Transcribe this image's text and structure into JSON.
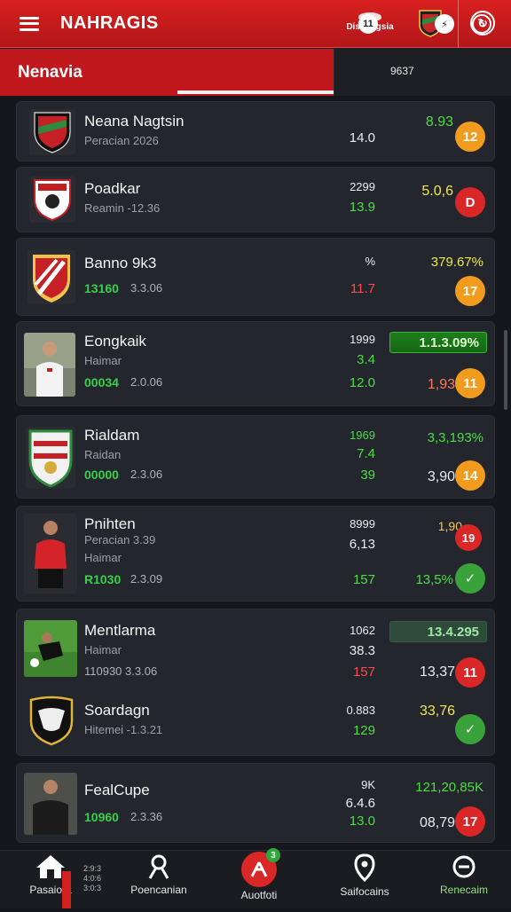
{
  "app": {
    "title": "NAHRAGIS",
    "brand": "Disbangsia"
  },
  "tab": {
    "title": "Nenavia",
    "notification_count": "11",
    "count_label": "9637",
    "right_pill": "6"
  },
  "cards": [
    {
      "name": "Neana Nagtsin",
      "sub": "Peracian 2026",
      "mid1": "14.0",
      "right1": "8.93",
      "badge": "12",
      "badge_color": "#f29c1f"
    },
    {
      "name": "Poadkar",
      "sub": "Reamin -12.36",
      "mid1": "2299",
      "mid2": "13.9",
      "right1": "5.0,6",
      "badge": "D",
      "badge_color": "#d92626"
    },
    {
      "name": "Banno 9k3",
      "sub_green": "13160",
      "sub_grey": "3.3.06",
      "mid1": "%",
      "mid2": "11.7",
      "right1": "379.67%",
      "badge": "17",
      "badge_color": "#f29c1f"
    },
    {
      "name": "Eongkaik",
      "sub": "Haimar",
      "sub_green": "00034",
      "sub_grey": "2.0.06",
      "mid1": "1999",
      "mid2": "3.4",
      "mid3": "12.0",
      "bar": "1.1.3.09%",
      "right2": "1,93",
      "badge": "11",
      "badge_color": "#f29c1f"
    },
    {
      "name": "Rialdam",
      "sub": "Raidan",
      "sub_green": "00000",
      "sub_grey": "2.3.06",
      "mid1": "1969",
      "mid2": "7.4",
      "mid3": "39",
      "right1": "3,3,193%",
      "right2": "3,90",
      "badge": "14",
      "badge_color": "#f29c1f"
    },
    {
      "name": "Pnihten",
      "sub": "Peracian 3.39",
      "sub2": "Haimar",
      "sub_green": "R1030",
      "sub_grey": "2.3.09",
      "mid1": "8999",
      "mid2": "6,13",
      "mid3": "157",
      "right1": "1,90",
      "badge": "19",
      "badge_color": "#d92626",
      "right2": "13,5%"
    },
    {
      "name": "Mentlarma",
      "sub": "Haimar",
      "sub_grey": "110930 3.3.06",
      "mid1": "1062",
      "mid2": "38.3",
      "mid3": "157",
      "bar": "13.4.295",
      "right2": "13,37",
      "badge": "11",
      "badge_color": "#d92626"
    },
    {
      "name": "Soardagn",
      "sub": "Hitemei -1.3.21",
      "mid1": "0.883",
      "mid2": "129",
      "right1": "33,76"
    },
    {
      "name": "FealCupe",
      "sub_green": "10960",
      "sub_grey": "2.3.36",
      "mid1": "9K",
      "mid2": "6.4.6",
      "mid3": "13.0",
      "right1": "121,20,85K",
      "right2": "08,79",
      "badge": "17",
      "badge_color": "#d92626"
    }
  ],
  "nav": [
    {
      "label": "Pasaiora",
      "icon": "home-icon",
      "side_text": "2:9:3 4:0:6 3:0:3"
    },
    {
      "label": "Poencanian",
      "icon": "profile-icon"
    },
    {
      "label": "Auotfoti",
      "icon": "action-icon",
      "badge": "3"
    },
    {
      "label": "Saifocains",
      "icon": "location-icon"
    },
    {
      "label": "Renecaim",
      "icon": "settings-icon"
    }
  ]
}
